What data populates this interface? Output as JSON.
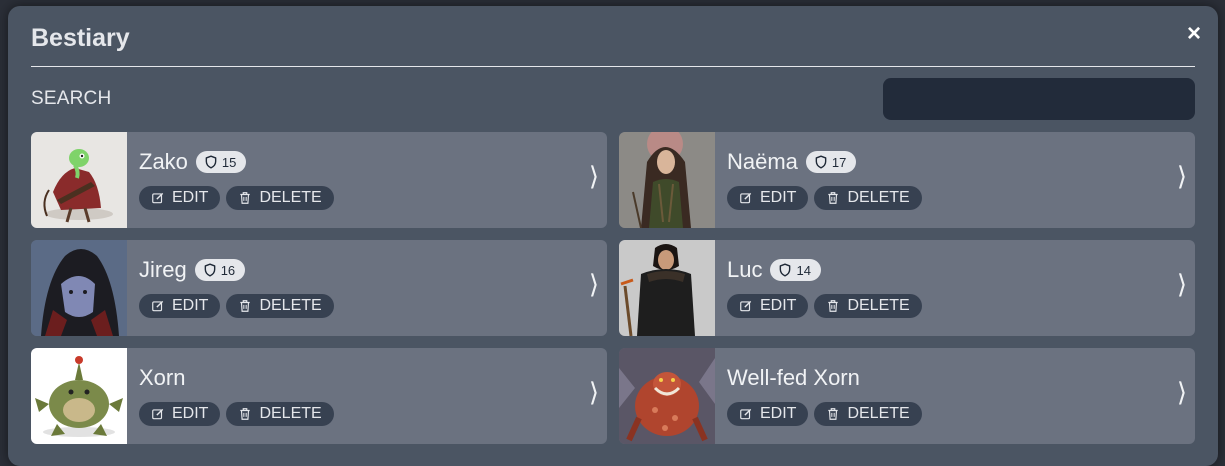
{
  "modal": {
    "title": "Bestiary",
    "close_label": "×"
  },
  "search": {
    "label": "SEARCH",
    "value": "",
    "placeholder": ""
  },
  "cards": [
    {
      "name": "Zako",
      "badge": "15",
      "edit_label": "EDIT",
      "delete_label": "DELETE",
      "chevron": "⟩"
    },
    {
      "name": "Naëma",
      "badge": "17",
      "edit_label": "EDIT",
      "delete_label": "DELETE",
      "chevron": "⟩"
    },
    {
      "name": "Jireg",
      "badge": "16",
      "edit_label": "EDIT",
      "delete_label": "DELETE",
      "chevron": "⟩"
    },
    {
      "name": "Luc",
      "badge": "14",
      "edit_label": "EDIT",
      "delete_label": "DELETE",
      "chevron": "⟩"
    },
    {
      "name": "Xorn",
      "edit_label": "EDIT",
      "delete_label": "DELETE",
      "chevron": "⟩"
    },
    {
      "name": "Well-fed Xorn",
      "edit_label": "EDIT",
      "delete_label": "DELETE",
      "chevron": "⟩"
    }
  ],
  "colors": {
    "modal_bg": "#4b5563",
    "card_bg": "#6b7280",
    "button_bg": "#374151",
    "search_bg": "#222b3a",
    "badge_bg": "#e5e7eb"
  },
  "icons": {
    "badge": "shield-icon",
    "edit": "edit-icon",
    "delete": "trash-icon",
    "open": "chevron-right-icon"
  }
}
